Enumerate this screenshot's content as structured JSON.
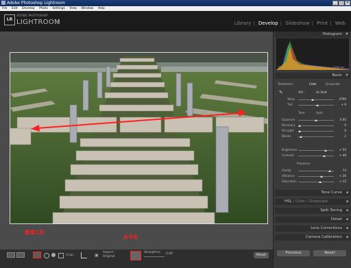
{
  "window": {
    "title": "Adobe Photoshop Lightroom"
  },
  "menu": [
    "File",
    "Edit",
    "Develop",
    "Photo",
    "Settings",
    "View",
    "Window",
    "Help"
  ],
  "header": {
    "badge": "LR",
    "brand_top": "ADOBE PHOTOSHOP",
    "brand_name": "LIGHTROOM",
    "version": "3"
  },
  "modules": [
    "Library",
    "Develop",
    "Slideshow",
    "Print",
    "Web"
  ],
  "active_module": "Develop",
  "panel": {
    "histogram_title": "Histogram",
    "hist_info": [
      "100 ISO",
      "40 mm",
      "f / 5.6",
      "1/160 sec"
    ],
    "basic_title": "Basic",
    "treatment_label": "Treatment :",
    "treatment_color": "Color",
    "treatment_gray": "Grayscale",
    "wb_label": "WB :",
    "wb_value": "As Shot",
    "temp_label": "Temp",
    "temp_value": "4790",
    "tint_label": "Tint",
    "tint_value": "+ 9",
    "tone_label": "Tone",
    "tone_auto": "Auto",
    "exposure_label": "Exposure",
    "exposure_value": "0.00",
    "recovery_label": "Recovery",
    "recovery_value": "0",
    "fill_label": "Fill Light",
    "fill_value": "0",
    "blacks_label": "Blacks",
    "blacks_value": "2",
    "brightness_label": "Brightness",
    "brightness_value": "+ 50",
    "contrast_label": "Contrast",
    "contrast_value": "+ 46",
    "presence_label": "Presence",
    "clarity_label": "Clarity",
    "clarity_value": "74",
    "vibrance_label": "Vibrance",
    "vibrance_value": "+ 26",
    "saturation_label": "Saturation",
    "saturation_value": "+ 12",
    "tone_curve": "Tone Curve",
    "hsl": "HSL",
    "hsl_color": "Color",
    "hsl_gray": "Grayscale",
    "split": "Split Toning",
    "detail": "Detail",
    "lens": "Lens Corrections",
    "camera": "Camera Calibration",
    "previous": "Previous",
    "reset": "Reset"
  },
  "toolbar": {
    "crop_label": "Crop :",
    "aspect_label": "Aspect :",
    "aspect_value": "Original",
    "straighten_label": "Straighten",
    "straighten_value": "0.00",
    "reset": "Reset",
    "ann_crop": "裁减工具",
    "ann_level": "水平仪"
  },
  "colors": {
    "accent_red": "#ff2020",
    "panel_bg": "#3a3a3a",
    "header_bg": "#1b1b1b"
  }
}
